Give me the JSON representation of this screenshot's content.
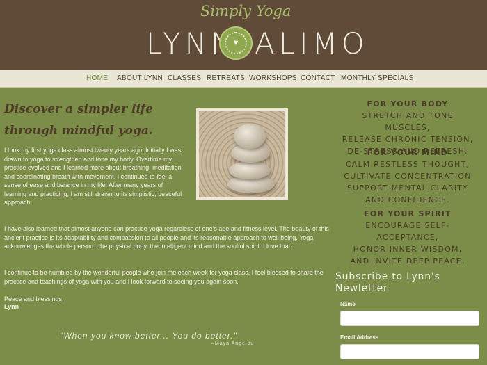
{
  "header": {
    "script_title": "Simply Yoga",
    "logo_left": "LYNN",
    "logo_right": "ALIMO",
    "logo_mark_symbol": "♥"
  },
  "nav": {
    "items": [
      {
        "label": "HOME",
        "active": true
      },
      {
        "label": "ABOUT LYNN",
        "active": false
      },
      {
        "label": "CLASSES",
        "active": false
      },
      {
        "label": "RETREATS",
        "active": false
      },
      {
        "label": "WORKSHOPS",
        "active": false
      },
      {
        "label": "CONTACT",
        "active": false
      },
      {
        "label": "MONTHLY SPECIALS",
        "active": false
      }
    ]
  },
  "main": {
    "headline_line1": "Discover a simpler life",
    "headline_line2": "through mindful yoga.",
    "paragraph1": "I took my first yoga class almost twenty years ago. Initially I was drawn to yoga to strengthen and tone my body.  Overtime my practice evolved and I learned more about breathing, meditation and coordinating breath with movement.  I continued to feel a sense of ease and balance in my life.   After many years of learning and practicing, I am still drawn to its simplistic, peaceful approach.",
    "paragraph2": "I have also learned that almost anyone can practice yoga regardless of one's age and fitness level.  The beauty of this ancient practice is its adaptability and compassion to all people and its reasonable approach to well being.  Yoga acknowledges the whole person...the physical body, the intelligent mind and the soulful spirit.  I love that.",
    "paragraph3": "I continue to be humbled by the wonderful people who join me each week for yoga class.  I feel blessed to share the practice and teachings of yoga with you and I look forward to seeing you again soon.",
    "closing": "Peace and blessings,",
    "signature": "Lynn",
    "quote": "\"When you know better... You do better.\"",
    "quote_author": "–Maya Angelou"
  },
  "sidebar": {
    "body_heading": "FOR YOUR BODY",
    "body_lines": [
      "STRETCH AND TONE MUSCLES,",
      "RELEASE CHRONIC TENSION,",
      "DE-STRESS AND REFRESH."
    ],
    "mind_heading": "FOR YOUR MIND",
    "mind_lines": [
      "CALM RESTLESS THOUGHT,",
      "CULTIVATE CONCENTRATION",
      "SUPPORT MENTAL CLARITY",
      "AND CONFIDENCE."
    ],
    "spirit_heading": "FOR YOUR SPIRIT",
    "spirit_lines": [
      "ENCOURAGE SELF-ACCEPTANCE,",
      "HONOR INNER WISDOM,",
      "AND INVITE DEEP PEACE."
    ],
    "subscribe_title_line1": "Subscribe to Lynn's",
    "subscribe_title_line2": "Newletter",
    "name_label": "Name",
    "name_value": "",
    "email_label": "Email Address",
    "email_value": ""
  },
  "colors": {
    "header_bg": "#5f4b38",
    "nav_bg": "#e9e6d6",
    "page_bg": "#7b8d48",
    "accent_green": "#a9be6a",
    "heading_brown": "#4e3a28"
  }
}
